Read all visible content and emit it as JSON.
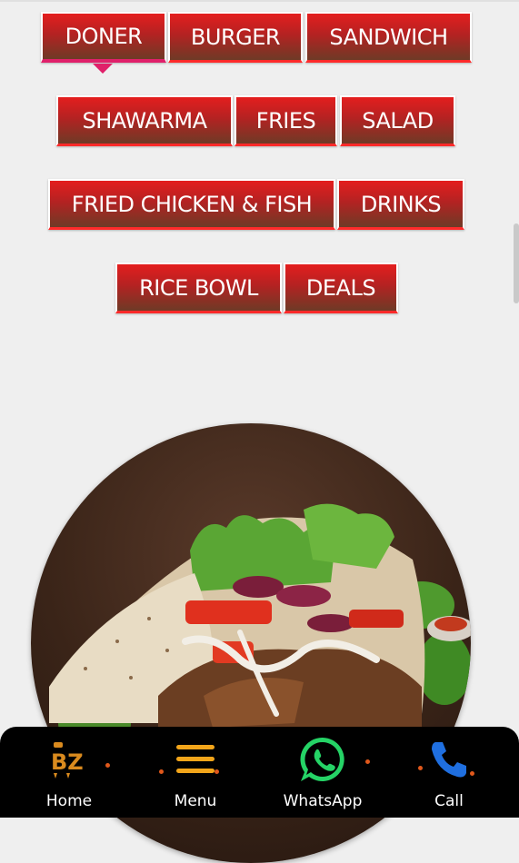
{
  "categories": [
    {
      "label": "DONER",
      "active": true
    },
    {
      "label": "BURGER"
    },
    {
      "label": "SANDWICH"
    },
    {
      "label": "SHAWARMA"
    },
    {
      "label": "FRIES"
    },
    {
      "label": "SALAD"
    },
    {
      "label": "FRIED CHICKEN & FISH"
    },
    {
      "label": "DRINKS"
    },
    {
      "label": "RICE BOWL"
    },
    {
      "label": "DEALS"
    }
  ],
  "hero": {
    "image": "doner-wrap-photo"
  },
  "bottom_nav": {
    "items": [
      {
        "label": "Home",
        "icon": "bz-logo-icon"
      },
      {
        "label": "Menu",
        "icon": "menu-icon"
      },
      {
        "label": "WhatsApp",
        "icon": "whatsapp-icon"
      },
      {
        "label": "Call",
        "icon": "phone-icon"
      }
    ]
  },
  "colors": {
    "tab_top": "#e41e1e",
    "tab_bottom": "#6e3a26",
    "active_indicator": "#e0206a",
    "nav_background": "#000000",
    "menu_icon": "#f2a51a",
    "whatsapp": "#25d366",
    "phone": "#1f6fe0"
  }
}
